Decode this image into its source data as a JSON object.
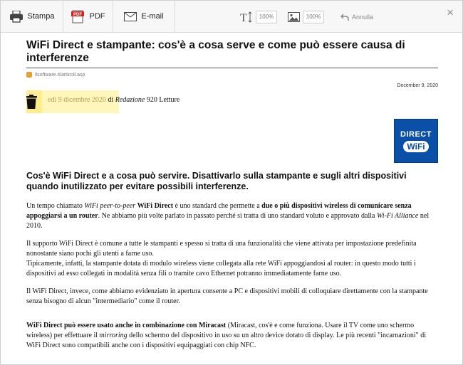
{
  "toolbar": {
    "print_label": "Stampa",
    "pdf_label": "PDF",
    "pdf_badge": "PDF",
    "email_label": "E-mail",
    "text_size": "100%",
    "image_size": "100%",
    "undo_label": "Annulla",
    "close_glyph": "×"
  },
  "article": {
    "title": "WiFi Direct e stampante: cos'è a cosa serve e come può essere causa di interferenze",
    "source_url": "ilsoftware.it/articoli.asp",
    "date": "December 9, 2020",
    "meta": {
      "day": "edì 9 dicembre 2020",
      "by": " di ",
      "author": "Redazione",
      "reads": " 920 Letture"
    },
    "logo": {
      "line1": "DIRECT",
      "line2": "WiFi"
    },
    "subtitle": "Cos'è WiFi Direct e a cosa può servire. Disattivarlo sulla stampante e sugli altri dispositivi quando inutilizzato per evitare possibili interferenze.",
    "p1": {
      "a": "Un tempo chiamato ",
      "b": "WiFi peer-to-peer",
      "c": " ",
      "d": "WiFi Direct",
      "e": " è uno standard che permette a ",
      "f": "due o più dispositivi wireless di comunicare senza appoggiarsi a un router",
      "g": ". Ne abbiamo più volte parlato in passato perché si tratta di uno standard voluto e approvato dalla ",
      "h": "Wi-Fi Alliance",
      "i": " nel 2010."
    },
    "p2a": "Il supporto WiFi Direct è comune a tutte le stampanti e spesso si tratta di una funzionalità che viene attivata per impostazione predefinita nonostante siano pochi gli utenti a farne uso.",
    "p2b": "Tipicamente, infatti, la stampante dotata di modulo wireless viene collegata alla rete WiFi appoggiandosi al router: in questo modo tutti i dispositivi ad esso collegati in modalità senza fili o tramite cavo Ethernet potranno immediatamente farne uso.",
    "p3": "Il WiFi Direct, invece, come abbiamo evidenziato in apertura consente a PC e dispositivi mobili di colloquiare direttamente con la stampante senza bisogno di alcun \"intermediario\" come il router.",
    "p4": {
      "a": "WiFi Direct può essere usato anche in combinazione con Miracast",
      "b": " (Miracast, cos'è e come funziona. Usare il TV come uno schermo wireless) per effettuare il ",
      "c": "mirroring",
      "d": " dello schermo del dispositivo in uso su un altro device dotato di display. Le più recenti \"incarnazioni\" di WiFi Direct sono compatibili anche con i dispositivi equipaggiati con chip NFC."
    }
  }
}
